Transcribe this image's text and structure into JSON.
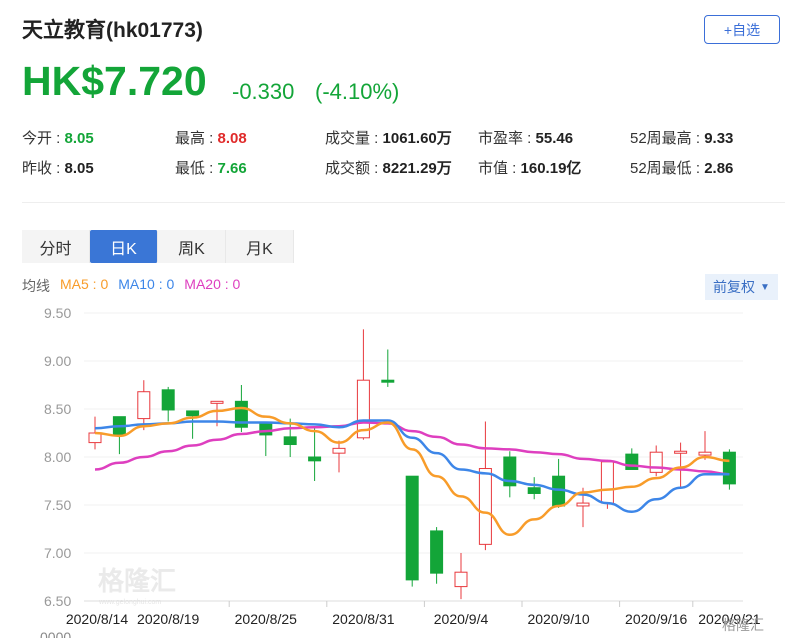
{
  "header": {
    "title": "天立教育(hk01773)",
    "add_watch": "+自选",
    "price": "HK$7.720",
    "change": "-0.330",
    "change_pct": "(-4.10%)"
  },
  "stats": [
    {
      "label": "今开",
      "value": "8.05",
      "color": "g"
    },
    {
      "label": "最高",
      "value": "8.08",
      "color": "r"
    },
    {
      "label": "成交量",
      "value": "1061.60万",
      "color": ""
    },
    {
      "label": "市盈率",
      "value": "55.46",
      "color": ""
    },
    {
      "label": "52周最高",
      "value": "9.33",
      "color": ""
    },
    {
      "label": "昨收",
      "value": "8.05",
      "color": ""
    },
    {
      "label": "最低",
      "value": "7.66",
      "color": "g"
    },
    {
      "label": "成交额",
      "value": "8221.29万",
      "color": ""
    },
    {
      "label": "市值",
      "value": "160.19亿",
      "color": ""
    },
    {
      "label": "52周最低",
      "value": "2.86",
      "color": ""
    }
  ],
  "tabs": [
    "分时",
    "日K",
    "周K",
    "月K"
  ],
  "active_tab": 1,
  "ma_legend": {
    "label": "均线",
    "ma5": "MA5 : 0",
    "ma10": "MA10 : 0",
    "ma20": "MA20 : 0"
  },
  "adjust_dropdown": "前复权",
  "watermark": "格隆汇",
  "watermark_url": "www.gelonghui.com",
  "corner_logo": "格隆汇",
  "volume_axis_cut": "0000",
  "colors": {
    "up": "#e8383d",
    "down": "#13a538",
    "ma5": "#f89c2a",
    "ma10": "#3d86e8",
    "ma20": "#de3fbf",
    "accent": "#3a76d6"
  },
  "chart_data": {
    "type": "candlestick",
    "ylim": [
      6.5,
      9.5
    ],
    "yticks": [
      "9.50",
      "9.00",
      "8.50",
      "8.00",
      "7.50",
      "7.00",
      "6.50"
    ],
    "xtick_labels": [
      {
        "i": 0,
        "label": "2020/8/14"
      },
      {
        "i": 3,
        "label": "2020/8/19"
      },
      {
        "i": 7,
        "label": "2020/8/25"
      },
      {
        "i": 11,
        "label": "2020/8/31"
      },
      {
        "i": 15,
        "label": "2020/9/4"
      },
      {
        "i": 19,
        "label": "2020/9/10"
      },
      {
        "i": 23,
        "label": "2020/9/16"
      },
      {
        "i": 26,
        "label": "2020/9/21"
      }
    ],
    "tick_marks": [
      5.5,
      9.5,
      13.5,
      17.5,
      21.5,
      24.5
    ],
    "ohlc": [
      [
        8.15,
        8.42,
        8.08,
        8.25
      ],
      [
        8.42,
        8.42,
        8.03,
        8.23
      ],
      [
        8.4,
        8.8,
        8.28,
        8.68
      ],
      [
        8.7,
        8.73,
        8.37,
        8.49
      ],
      [
        8.48,
        8.48,
        8.19,
        8.43
      ],
      [
        8.57,
        8.58,
        8.32,
        8.58
      ],
      [
        8.58,
        8.75,
        8.26,
        8.31
      ],
      [
        8.35,
        8.35,
        8.01,
        8.23
      ],
      [
        8.21,
        8.4,
        8.0,
        8.13
      ],
      [
        8.0,
        8.32,
        7.75,
        7.96
      ],
      [
        8.04,
        8.17,
        7.84,
        8.09
      ],
      [
        8.2,
        9.33,
        8.18,
        8.8
      ],
      [
        8.8,
        9.12,
        8.73,
        8.78
      ],
      [
        7.8,
        7.8,
        6.65,
        6.72
      ],
      [
        7.23,
        7.27,
        6.68,
        6.79
      ],
      [
        6.65,
        7.0,
        6.52,
        6.8
      ],
      [
        7.09,
        8.37,
        7.03,
        7.88
      ],
      [
        8.0,
        8.06,
        7.58,
        7.7
      ],
      [
        7.68,
        7.79,
        7.56,
        7.62
      ],
      [
        7.8,
        7.98,
        7.47,
        7.49
      ],
      [
        7.49,
        7.68,
        7.27,
        7.52
      ],
      [
        7.52,
        7.97,
        7.46,
        7.95
      ],
      [
        8.03,
        8.09,
        7.87,
        7.87
      ],
      [
        7.84,
        8.12,
        7.8,
        8.05
      ],
      [
        8.05,
        8.15,
        7.68,
        8.06
      ],
      [
        8.02,
        8.27,
        7.97,
        8.05
      ],
      [
        8.05,
        8.08,
        7.66,
        7.72
      ]
    ],
    "series": [
      {
        "name": "MA5",
        "values": [
          8.25,
          8.22,
          8.32,
          8.35,
          8.41,
          8.48,
          8.51,
          8.42,
          8.35,
          8.27,
          8.15,
          8.28,
          8.36,
          8.08,
          7.8,
          7.59,
          7.42,
          7.19,
          7.35,
          7.49,
          7.63,
          7.66,
          7.69,
          7.78,
          7.89,
          8.0,
          7.96
        ]
      },
      {
        "name": "MA10",
        "values": [
          8.3,
          8.32,
          8.34,
          8.35,
          8.37,
          8.37,
          8.36,
          8.36,
          8.35,
          8.34,
          8.31,
          8.38,
          8.38,
          8.2,
          8.04,
          7.87,
          7.83,
          7.75,
          7.71,
          7.66,
          7.61,
          7.52,
          7.43,
          7.56,
          7.68,
          7.82,
          7.82
        ]
      },
      {
        "name": "MA20",
        "values": [
          7.87,
          7.94,
          8.0,
          8.06,
          8.12,
          8.18,
          8.24,
          8.27,
          8.3,
          8.31,
          8.32,
          8.36,
          8.35,
          8.27,
          8.21,
          8.13,
          8.09,
          8.08,
          8.05,
          8.03,
          7.98,
          7.96,
          7.91,
          7.89,
          7.87,
          7.85,
          7.82
        ]
      }
    ]
  }
}
